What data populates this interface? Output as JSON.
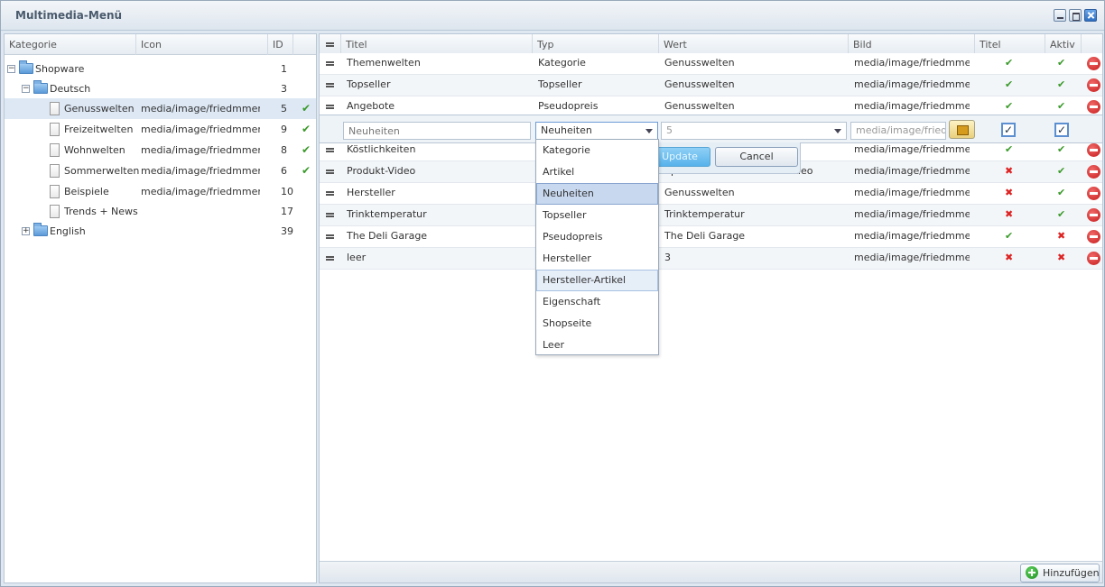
{
  "window": {
    "title": "Multimedia-Menü"
  },
  "tree": {
    "columns": [
      "Kategorie",
      "Icon",
      "ID"
    ],
    "nodes": [
      {
        "label": "Shopware",
        "icon": "",
        "id": "1",
        "check": ""
      },
      {
        "label": "Deutsch",
        "icon": "",
        "id": "3",
        "check": ""
      },
      {
        "label": "Genusswelten",
        "icon": "media/image/friedmmenu...",
        "id": "5",
        "check": "✔"
      },
      {
        "label": "Freizeitwelten",
        "icon": "media/image/friedmmenu...",
        "id": "9",
        "check": "✔"
      },
      {
        "label": "Wohnwelten",
        "icon": "media/image/friedmmenu...",
        "id": "8",
        "check": "✔"
      },
      {
        "label": "Sommerwelten",
        "icon": "media/image/friedmmenu...",
        "id": "6",
        "check": "✔"
      },
      {
        "label": "Beispiele",
        "icon": "media/image/friedmmenu...",
        "id": "10",
        "check": ""
      },
      {
        "label": "Trends + News",
        "icon": "",
        "id": "17",
        "check": ""
      },
      {
        "label": "English",
        "icon": "",
        "id": "39",
        "check": ""
      }
    ]
  },
  "grid": {
    "columns": [
      "Titel",
      "Typ",
      "Wert",
      "Bild",
      "Titel verlinken",
      "Aktiv"
    ],
    "rows": [
      {
        "titel": "Themenwelten",
        "typ": "Kategorie",
        "wert": "Genusswelten",
        "bild": "media/image/friedmmen...",
        "link": "✔",
        "aktiv": "✔"
      },
      {
        "titel": "Topseller",
        "typ": "Topseller",
        "wert": "Genusswelten",
        "bild": "media/image/friedmmen...",
        "link": "✔",
        "aktiv": "✔"
      },
      {
        "titel": "Angebote",
        "typ": "Pseudopreis",
        "wert": "Genusswelten",
        "bild": "media/image/friedmmen...",
        "link": "✔",
        "aktiv": "✔"
      },
      {
        "titel": "Köstlichkeiten",
        "typ": "",
        "wert": "",
        "bild": "media/image/friedmmen...",
        "link": "✔",
        "aktiv": "✔"
      },
      {
        "titel": "Produkt-Video",
        "typ": "",
        "wert": "Spaetleifraesse Produkt-Video",
        "bild": "media/image/friedmmen...",
        "link": "✖",
        "aktiv": "✔"
      },
      {
        "titel": "Hersteller",
        "typ": "",
        "wert": "Genusswelten",
        "bild": "media/image/friedmmen...",
        "link": "✖",
        "aktiv": "✔"
      },
      {
        "titel": "Trinktemperatur",
        "typ": "",
        "wert": "Trinktemperatur",
        "bild": "media/image/friedmmen...",
        "link": "✖",
        "aktiv": "✔"
      },
      {
        "titel": "The Deli Garage",
        "typ": "",
        "wert": "The Deli Garage",
        "bild": "media/image/friedmmen...",
        "link": "✔",
        "aktiv": "✖"
      },
      {
        "titel": "leer",
        "typ": "",
        "wert": "3",
        "bild": "media/image/friedmmen...",
        "link": "✖",
        "aktiv": "✖"
      }
    ],
    "editor": {
      "titel_placeholder": "Neuheiten",
      "typ_value": "Neuheiten",
      "wert_value": "5",
      "bild_value": "media/image/friedm",
      "link_checked": "✓",
      "aktiv_checked": "✓",
      "update_label": "Update",
      "cancel_label": "Cancel"
    },
    "typ_options": [
      "Kategorie",
      "Artikel",
      "Neuheiten",
      "Topseller",
      "Pseudopreis",
      "Hersteller",
      "Hersteller-Artikel",
      "Eigenschaft",
      "Shopseite",
      "Leer"
    ],
    "add_label": "Hinzufügen"
  }
}
